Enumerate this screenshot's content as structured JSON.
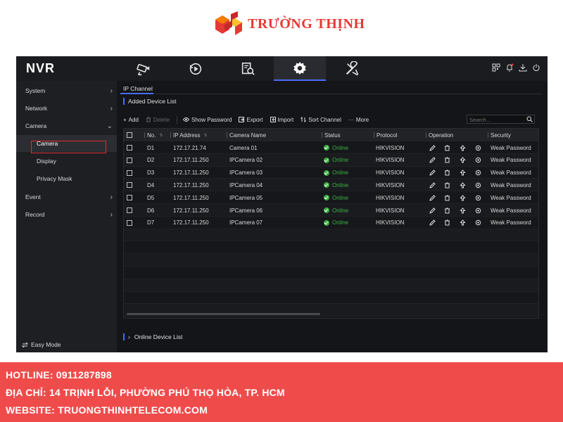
{
  "brand": {
    "name": "TRƯỜNG THỊNH",
    "logo_icon": "truong-thinh-logo",
    "accent": "#e53935"
  },
  "nvr": {
    "logo": "NVR",
    "top_nav": [
      {
        "icon": "camera-icon",
        "active": false
      },
      {
        "icon": "playback-icon",
        "active": false
      },
      {
        "icon": "search-file-icon",
        "active": false
      },
      {
        "icon": "gear-icon",
        "active": true
      },
      {
        "icon": "tools-icon",
        "active": false
      }
    ],
    "top_right_icons": [
      "qr-code-icon",
      "bell-icon",
      "download-icon",
      "power-icon"
    ],
    "sidebar": {
      "items": [
        {
          "label": "System",
          "chevron": "›"
        },
        {
          "label": "Network",
          "chevron": "›"
        },
        {
          "label": "Camera",
          "chevron": "⌄"
        },
        {
          "label": "Camera"
        },
        {
          "label": "Display"
        },
        {
          "label": "Privacy Mask"
        },
        {
          "label": "Event",
          "chevron": "›"
        },
        {
          "label": "Record",
          "chevron": "›"
        }
      ],
      "easy_mode": "Easy Mode"
    },
    "tab": "IP Channel",
    "section_title": "Added Device List",
    "toolbar": {
      "add": "Add",
      "delete": "Delete",
      "show_password": "Show Password",
      "export": "Export",
      "import": "Import",
      "sort_channel": "Sort Channel",
      "more": "More"
    },
    "search_placeholder": "Search...",
    "columns": {
      "no": "No.",
      "ip": "IP Address",
      "name": "Camera Name",
      "status": "Status",
      "protocol": "Protocol",
      "operation": "Operation",
      "security": "Security"
    },
    "rows": [
      {
        "no": "D1",
        "ip": "172.17.21.74",
        "name": "Camera 01",
        "status": "Online",
        "protocol": "HIKVISION",
        "security": "Weak Password"
      },
      {
        "no": "D2",
        "ip": "172.17.11.250",
        "name": "IPCamera 02",
        "status": "Online",
        "protocol": "HIKVISION",
        "security": "Weak Password"
      },
      {
        "no": "D3",
        "ip": "172.17.11.250",
        "name": "IPCamera 03",
        "status": "Online",
        "protocol": "HIKVISION",
        "security": "Weak Password"
      },
      {
        "no": "D4",
        "ip": "172.17.11.250",
        "name": "IPCamera 04",
        "status": "Online",
        "protocol": "HIKVISION",
        "security": "Weak Password"
      },
      {
        "no": "D5",
        "ip": "172.17.11.250",
        "name": "IPCamera 05",
        "status": "Online",
        "protocol": "HIKVISION",
        "security": "Weak Password"
      },
      {
        "no": "D6",
        "ip": "172.17.11.250",
        "name": "IPCamera 06",
        "status": "Online",
        "protocol": "HIKVISION",
        "security": "Weak Password"
      },
      {
        "no": "D7",
        "ip": "172.17.11.250",
        "name": "IPCamera 07",
        "status": "Online",
        "protocol": "HIKVISION",
        "security": "Weak Password"
      }
    ],
    "online_device_list": "Online Device List",
    "colors": {
      "accent": "#4a6cf7",
      "online": "#3cb043",
      "highlight": "#e03030"
    }
  },
  "footer": {
    "hotline": "HOTLINE: 0911287898",
    "address": "ĐỊA CHỈ: 14 TRỊNH LỖI, PHƯỜNG PHÚ THỌ HÒA, TP. HCM",
    "website": "WEBSITE: TRUONGTHINHTELECOM.COM",
    "color": "#ef4b4b"
  }
}
